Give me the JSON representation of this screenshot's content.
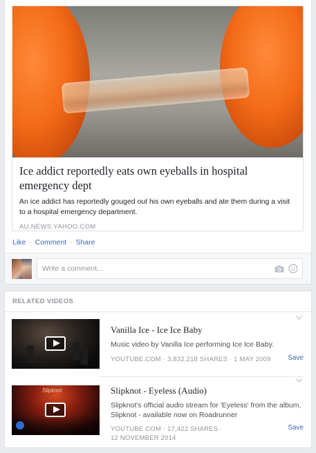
{
  "post": {
    "link": {
      "image_alt": "Ice addict reportedly eats own eyeballs in hospital emergency dept",
      "title": "Ice addict reportedly eats own eyeballs in hospital emergency dept",
      "description": "An ice addict has reportedly gouged out his own eyeballs and ate them during a visit to a hospital emergency department.",
      "domain": "AU.NEWS.YAHOO.COM"
    },
    "actions": {
      "like": "Like",
      "comment": "Comment",
      "share": "Share",
      "separator": "·"
    },
    "comment_box": {
      "placeholder": "Write a comment..."
    }
  },
  "related_videos": {
    "header": "RELATED VIDEOS",
    "items": [
      {
        "title": "Vanilla Ice - Ice Ice Baby",
        "description": "Music video by Vanilla Ice performing Ice Ice Baby.",
        "meta": "YOUTUBE.COM · 3,832,218 SHARES · 1 MAY 2009",
        "save": "Save"
      },
      {
        "title": "Slipknot - Eyeless (Audio)",
        "description": "Slipknot's official audio stream for 'Eyeless' from the album, Slipknot - available now on Roadrunner",
        "meta_line1": "YOUTUBE.COM · 17,422 SHARES ·",
        "meta_line2": "12 NOVEMBER 2014",
        "save": "Save",
        "thumb_text": "Slipknot"
      }
    ]
  },
  "colors": {
    "link_blue": "#4267b2",
    "muted_gray": "#90949c",
    "page_bg": "#e9ebee"
  },
  "icons": [
    "camera-icon",
    "smile-icon",
    "play-icon",
    "chevron-down-icon"
  ]
}
